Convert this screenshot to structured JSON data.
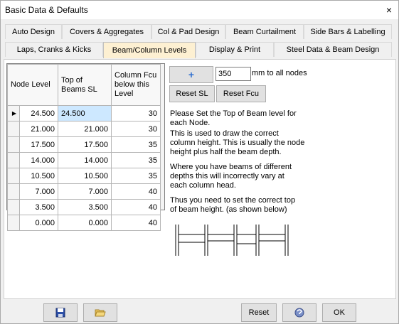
{
  "window": {
    "title": "Basic Data & Defaults",
    "close_glyph": "×"
  },
  "tabs_row1": [
    "Auto Design",
    "Covers & Aggregates",
    "Col & Pad Design",
    "Beam Curtailment",
    "Side Bars & Labelling"
  ],
  "tabs_row2": [
    "Laps, Cranks & Kicks",
    "Beam/Column Levels",
    "Display & Print",
    "Steel Data & Beam Design"
  ],
  "active_tab": "Beam/Column Levels",
  "grid": {
    "headers": [
      "Node Level",
      "Top of Beams SL",
      "Column Fcu below this Level"
    ],
    "rows": [
      [
        "24.500",
        "24.500",
        "30"
      ],
      [
        "21.000",
        "21.000",
        "30"
      ],
      [
        "17.500",
        "17.500",
        "35"
      ],
      [
        "14.000",
        "14.000",
        "35"
      ],
      [
        "10.500",
        "10.500",
        "35"
      ],
      [
        "7.000",
        "7.000",
        "40"
      ],
      [
        "3.500",
        "3.500",
        "40"
      ],
      [
        "0.000",
        "0.000",
        "40"
      ]
    ],
    "row_indicator": "▶"
  },
  "controls": {
    "plus_label": "+",
    "amount_value": "350",
    "amount_suffix": "mm to all nodes",
    "reset_sl": "Reset SL",
    "reset_fcu": "Reset Fcu"
  },
  "info": {
    "p1": "Please Set the Top of Beam level for each Node.",
    "p2": "This is used to draw the correct column height. This is usually the node height plus half the beam depth.",
    "p3": "Where you have beams of different depths this will incorrectly vary at each column head.",
    "p4": "Thus you need to set the correct top of beam height. (as shown below)"
  },
  "footer": {
    "reset": "Reset",
    "ok": "OK"
  },
  "colors": {
    "active_tab": "#fdf0d2",
    "selected_cell": "#cde8ff",
    "plus_blue": "#2f6fd0"
  }
}
